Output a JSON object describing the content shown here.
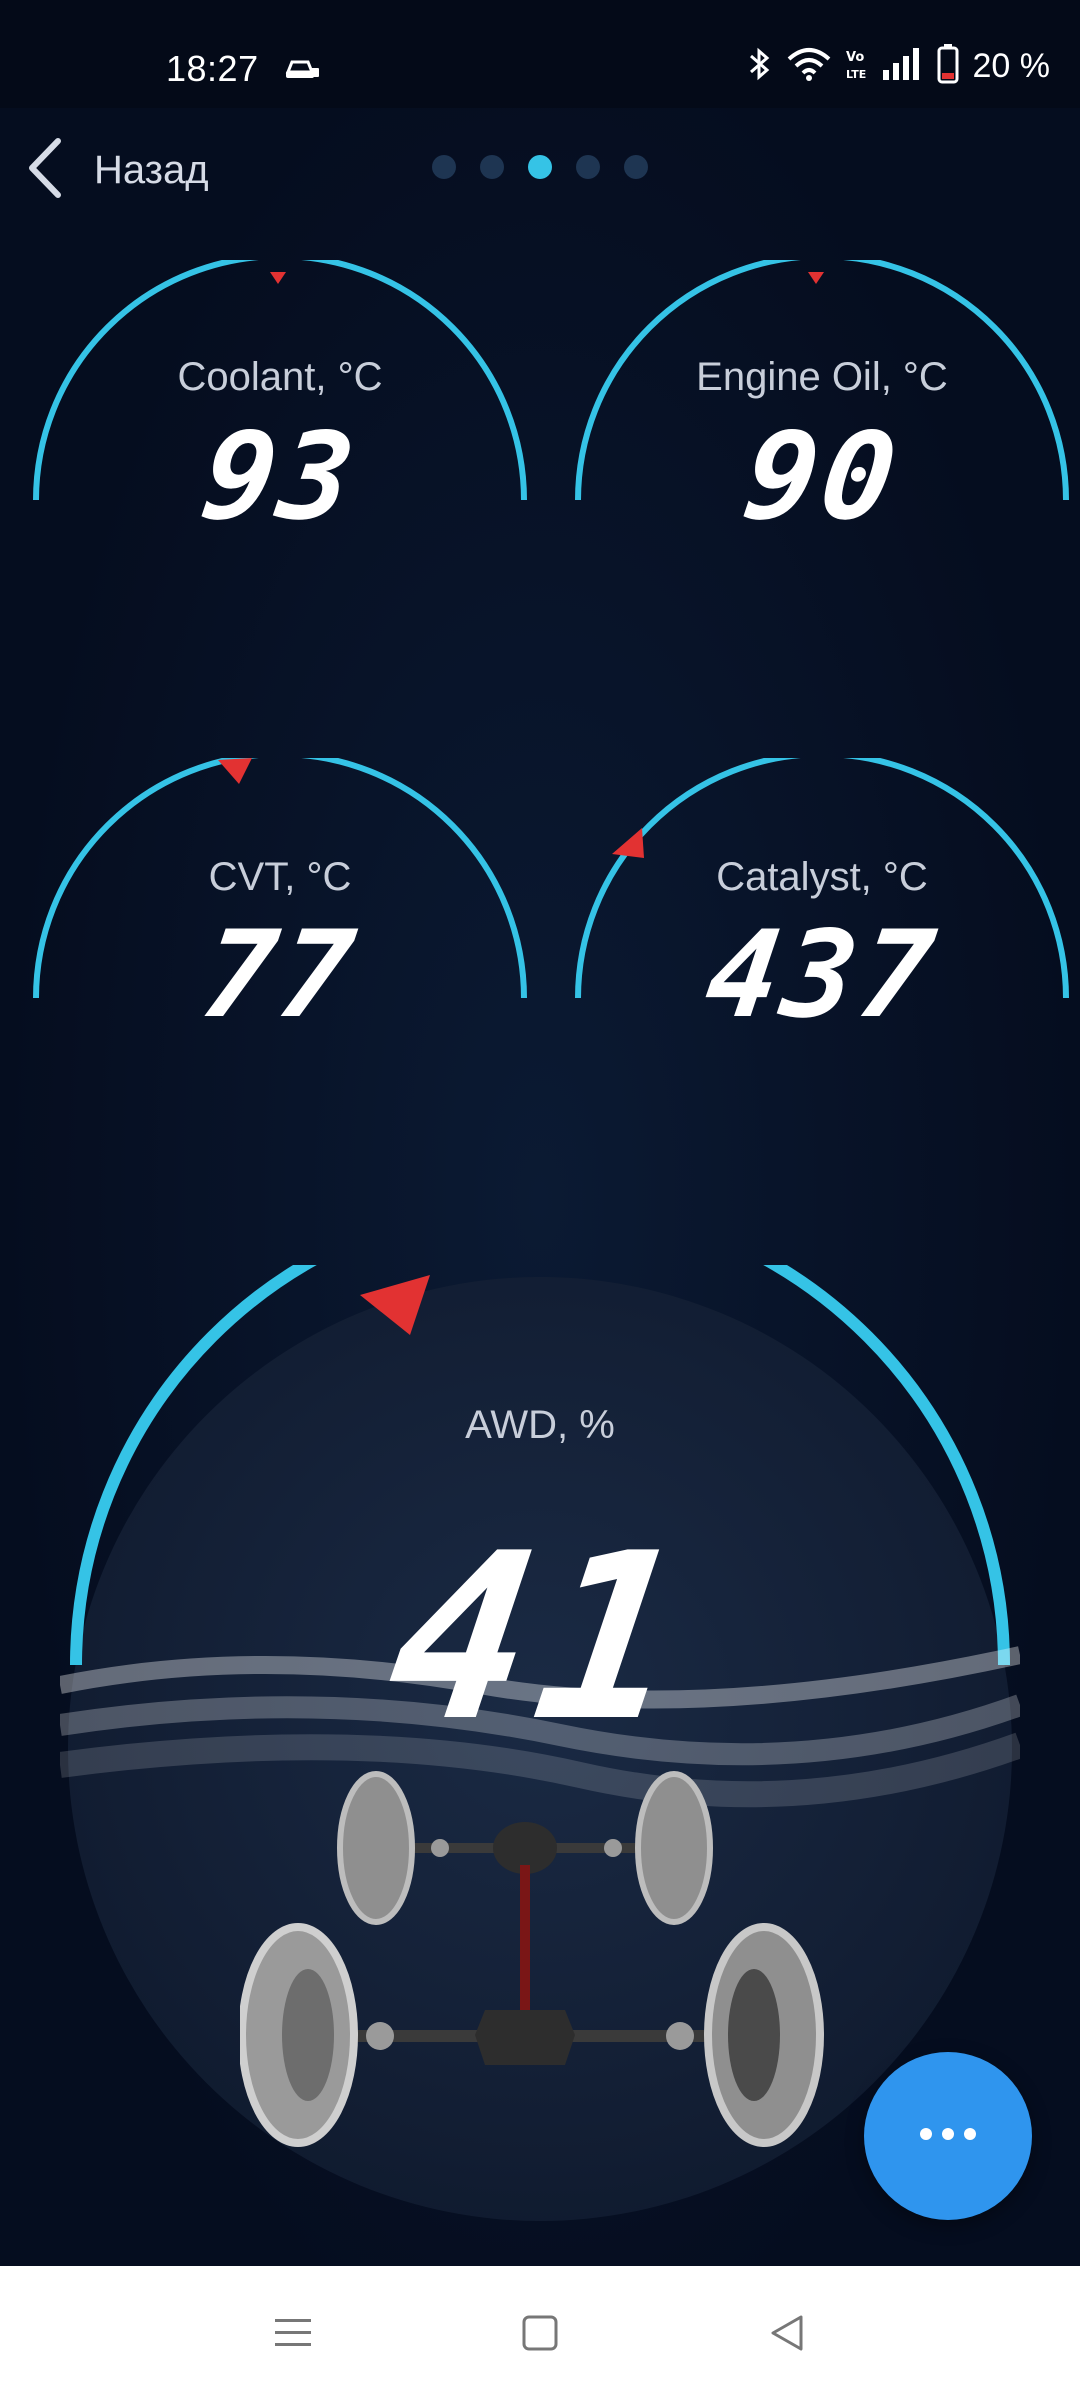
{
  "status_bar": {
    "time": "18:27",
    "battery_text": "20 %",
    "icons": [
      "car-lock-icon",
      "bluetooth-icon",
      "wifi-icon",
      "volte-icon",
      "signal-icon",
      "battery-icon"
    ]
  },
  "header": {
    "back_label": "Назад",
    "pager": {
      "total": 5,
      "active_index": 2
    }
  },
  "gauges": [
    {
      "label": "Coolant, °C",
      "value": "93"
    },
    {
      "label": "Engine Oil, °C",
      "value": "90"
    },
    {
      "label": "CVT, °C",
      "value": "77"
    },
    {
      "label": "Catalyst, °C",
      "value": "437"
    }
  ],
  "awd": {
    "label": "AWD, %",
    "value": "41"
  },
  "colors": {
    "arc": "#35c3e6",
    "pointer": "#e23232",
    "fab": "#2f95ee",
    "background": "#050d1f"
  },
  "fab": {
    "icon": "more-horizontal-icon"
  },
  "nav": {
    "icons": [
      "menu-icon",
      "home-square-icon",
      "back-triangle-icon"
    ]
  }
}
